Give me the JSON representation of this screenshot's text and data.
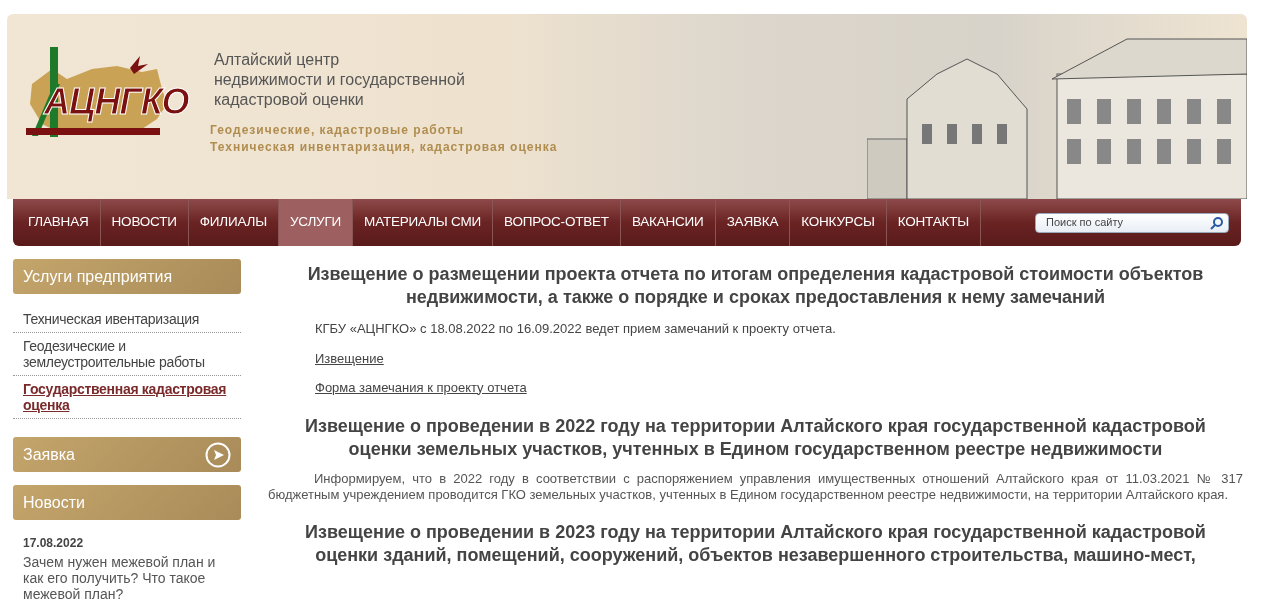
{
  "header": {
    "logo_text": "АЦНГКО",
    "org_name": [
      "Алтайский центр",
      "недвижимости и государственной",
      "кадастровой оценки"
    ],
    "taglines": [
      "Геодезические, кадастровые работы",
      "Техническая инвентаризация, кадастровая оценка"
    ]
  },
  "nav": {
    "items": [
      {
        "label": "ГЛАВНАЯ",
        "selected": false
      },
      {
        "label": "НОВОСТИ",
        "selected": false
      },
      {
        "label": "ФИЛИАЛЫ",
        "selected": false
      },
      {
        "label": "УСЛУГИ",
        "selected": true
      },
      {
        "label": "МАТЕРИАЛЫ СМИ",
        "selected": false
      },
      {
        "label": "ВОПРОС-ОТВЕТ",
        "selected": false
      },
      {
        "label": "ВАКАНСИИ",
        "selected": false
      },
      {
        "label": "ЗАЯВКА",
        "selected": false
      },
      {
        "label": "КОНКУРСЫ",
        "selected": false
      },
      {
        "label": "КОНТАКТЫ",
        "selected": false
      }
    ],
    "search": {
      "placeholder": "Поиск по сайту"
    }
  },
  "sidebar": [
    {
      "kind": "menu",
      "title": "Услуги предприятия",
      "items": [
        {
          "label": "Техническая ивентаризация",
          "selected": false
        },
        {
          "label": "Геодезические и землеустроительные работы",
          "selected": false
        },
        {
          "label": "Государственная кадастровая оценка",
          "selected": true
        }
      ]
    },
    {
      "kind": "link",
      "title": "Заявка"
    },
    {
      "kind": "news",
      "title": "Новости",
      "items": [
        {
          "date": "17.08.2022",
          "text": "Зачем нужен межевой план и как его получить? Что такое межевой план?"
        }
      ]
    }
  ],
  "articles": [
    {
      "title": "Извещение о размещении проекта отчета по итогам определения кадастровой стоимости объектов недвижимости, а также о порядке и сроках предоставления к нему замечаний",
      "blocks": [
        {
          "kind": "text",
          "text": "КГБУ «АЦНГКО» с 18.08.2022 по 16.09.2022 ведет прием замечаний к проекту отчета."
        },
        {
          "kind": "link",
          "text": "Извещение"
        },
        {
          "kind": "link",
          "text": "Форма замечания к проекту отчета"
        }
      ]
    },
    {
      "title": "Извещение о проведении в 2022 году на территории Алтайского края государственной кадастровой оценки земельных участков, учтенных в Едином государственном реестре недвижимости",
      "blocks": [
        {
          "kind": "paragraph",
          "text": "Информируем, что в 2022 году в соответствии с распоряжением управления имущественных отношений Алтайского края от 11.03.2021 № 317 бюджетным учреждением проводится ГКО земельных участков, учтенных в Едином государственном реестре недвижимости, на территории Алтайского края."
        }
      ]
    },
    {
      "title": "Извещение о проведении в 2023 году на территории Алтайского края государственной кадастровой оценки зданий, помещений, сооружений, объектов незавершенного строительства, машино-мест,"
    }
  ]
}
